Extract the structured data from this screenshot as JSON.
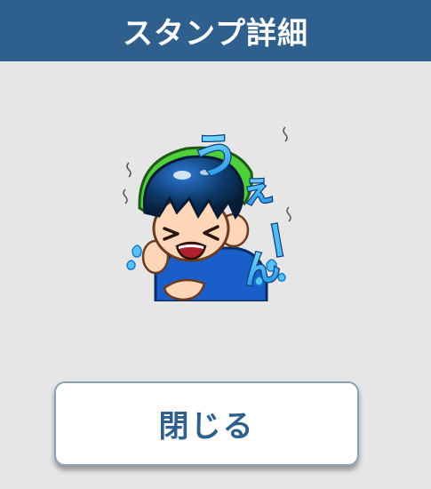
{
  "header": {
    "title": "スタンプ詳細"
  },
  "sticker": {
    "icon": "crying-boy-sticker-icon",
    "text": "うぇーん",
    "colors": {
      "text_fill": "#3fb6ff",
      "hair_dark": "#0e3a6a",
      "hair_green": "#4fcf3a",
      "shirt": "#1a5fc9",
      "skin": "#ffd7b8"
    }
  },
  "footer": {
    "close_label": "閉じる"
  },
  "colors": {
    "header_bg": "#2f5f8c",
    "page_bg": "#e6e6e6",
    "button_text": "#2f5f8c",
    "button_border": "#8aa2b8"
  }
}
